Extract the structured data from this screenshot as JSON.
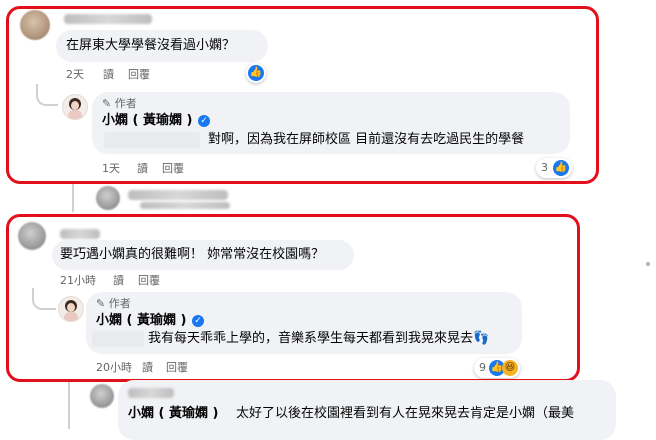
{
  "comment1": {
    "text": "在屏東大學學餐沒看過小嫻？",
    "time": "2天",
    "read": "讀",
    "reply": "回覆"
  },
  "reply1": {
    "author_badge": "作者",
    "name": "小嫻 ( 黃瑜嫻 )",
    "text": "對啊，因為我在屏師校區 目前還沒有去吃過民生的學餐",
    "time": "1天",
    "read": "讀",
    "reply": "回覆",
    "reaction_count": "3"
  },
  "comment2": {
    "text": "要巧遇小嫻真的很難啊！ 妳常常沒在校園嗎？",
    "time": "21小時",
    "read": "讀",
    "reply": "回覆"
  },
  "reply2": {
    "author_badge": "作者",
    "name": "小嫻 ( 黃瑜嫻 )",
    "text": "我有每天乖乖上學的，音樂系學生每天都看到我晃來晃去👣",
    "time": "20小時",
    "read": "讀",
    "reply": "回覆",
    "reaction_count": "9"
  },
  "reply3": {
    "name": "小嫻 ( 黃瑜嫻 )",
    "text": "太好了以後在校園裡看到有人在晃來晃去肯定是小嫻（最美"
  },
  "colors": {
    "highlight": "#e3101b",
    "like": "#1877f2",
    "bubble": "#f0f2f5",
    "meta": "#65676b"
  },
  "icons": [
    "like-icon",
    "haha-icon",
    "verified-icon",
    "pencil-icon"
  ]
}
